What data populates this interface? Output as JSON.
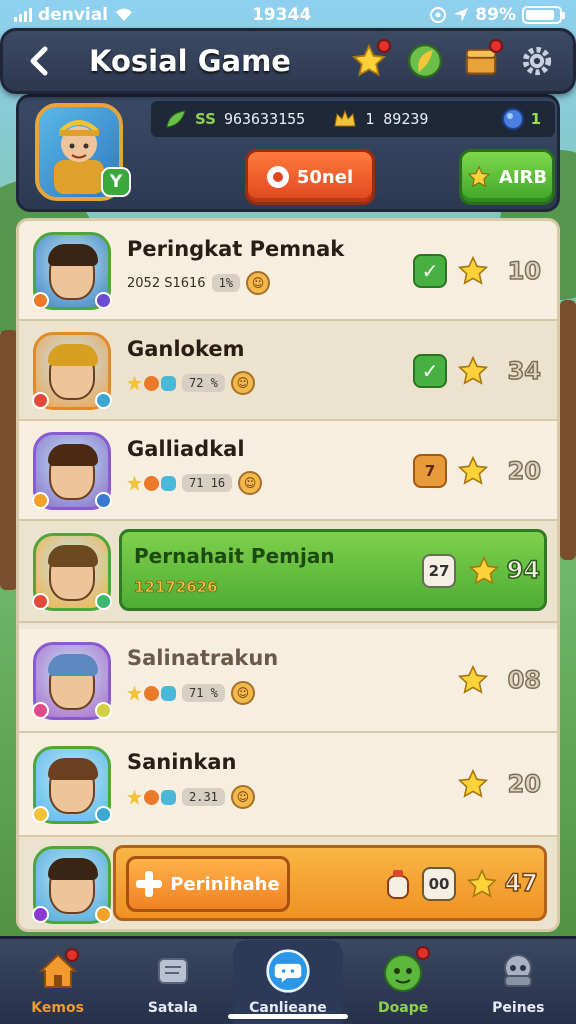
{
  "status_bar": {
    "carrier": "denvial",
    "time": "19344",
    "battery_percent": "89%",
    "battery_level": 0.89
  },
  "header": {
    "title": "Kosial Game",
    "icons": [
      "star-icon",
      "leaf-orb-icon",
      "chest-icon",
      "gear-icon"
    ]
  },
  "profile": {
    "badge": "Y",
    "resources": [
      {
        "icon": "leaf-icon",
        "prefix": "SS",
        "value": "963633155"
      },
      {
        "icon": "crown-icon",
        "prefix": "",
        "value": "1 89239"
      }
    ],
    "gem_count": "1",
    "primary_button": "50nel",
    "secondary_button": "AIRB"
  },
  "leaderboard": [
    {
      "name": "Peringkat Pemnak",
      "meta": "2052 S1616",
      "pill": "1%",
      "score": "10",
      "status": "check",
      "avatar_color": "#3f82c0",
      "hair": "#3a2413"
    },
    {
      "name": "Ganlokem",
      "meta": "",
      "pill": "72 %",
      "score": "34",
      "status": "check",
      "avatar_color": "#f0a24a",
      "hair": "#d8a020"
    },
    {
      "name": "Galliadkal",
      "meta": "",
      "pill": "71 16",
      "score": "20",
      "status": "7",
      "avatar_color": "#8a6fc8",
      "hair": "#4a2a14"
    },
    {
      "name": "Pernahait Pemjan",
      "meta": "12172626",
      "pill": "",
      "score": "94",
      "status": "27",
      "avatar_color": "#f4b040",
      "hair": "#6b4a20"
    },
    {
      "name": "Salinatrakun",
      "meta": "",
      "pill": "71 %",
      "score": "08",
      "status": "",
      "avatar_color": "#b06ac8",
      "hair": "#5c8ac0"
    },
    {
      "name": "Saninkan",
      "meta": "",
      "pill": "2.31",
      "score": "20",
      "status": "",
      "avatar_color": "#58b8e8",
      "hair": "#6b3f1f"
    },
    {
      "name": "Perinihahe",
      "meta": "",
      "pill": "",
      "score": "47",
      "status": "00",
      "avatar_color": "#4fa8d8",
      "hair": "#3a2413"
    }
  ],
  "nav": [
    {
      "label": "Kemos",
      "icon": "house-icon",
      "color": "#f29a2e"
    },
    {
      "label": "Satala",
      "icon": "scroll-icon",
      "color": "#e6eaf2"
    },
    {
      "label": "Canlieane",
      "icon": "chat-icon",
      "color": "#ffffff"
    },
    {
      "label": "Doape",
      "icon": "dragon-icon",
      "color": "#8fd04c"
    },
    {
      "label": "Peines",
      "icon": "settings-robot-icon",
      "color": "#e6eaf2"
    }
  ]
}
